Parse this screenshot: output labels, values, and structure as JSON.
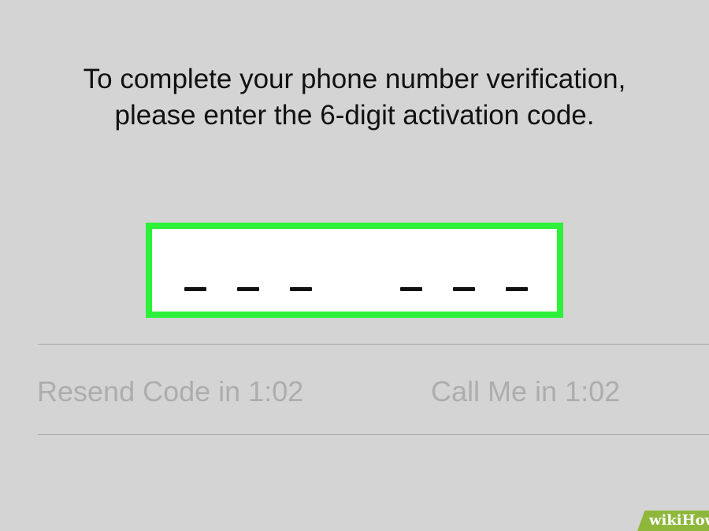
{
  "instructions": {
    "line1": "To complete your phone number verification,",
    "line2": "please enter the 6-digit activation code."
  },
  "code_input": {
    "digit_count": 6,
    "highlight_color": "#2df03a",
    "value": ""
  },
  "actions": {
    "resend_label": "Resend Code in 1:02",
    "call_label": "Call Me in 1:02"
  },
  "watermark": {
    "brand": "wikiHow"
  }
}
